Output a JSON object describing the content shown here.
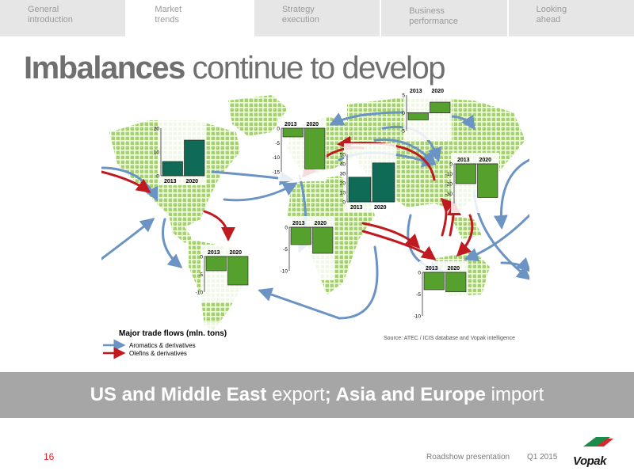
{
  "tabs": [
    {
      "label": "General\nintroduction"
    },
    {
      "label": "Market\ntrends"
    },
    {
      "label": "Strategy\nexecution"
    },
    {
      "label": "Business\nperformance"
    },
    {
      "label": "Looking\nahead"
    }
  ],
  "title": {
    "bold": "Imbalances",
    "rest": " continue to develop"
  },
  "map": {
    "legend_title": "Major trade flows (mln. tons)",
    "legend_items": [
      {
        "label": "Aromatics & derivatives",
        "color": "#6b93c4"
      },
      {
        "label": "Olefins & derivatives",
        "color": "#c0191f"
      }
    ],
    "source": "Source: ATEC / ICIS database and Vopak intelligence"
  },
  "colors": {
    "dark_green": "#0f6b55",
    "light_green": "#56a02d",
    "land": "#9fcf6c",
    "flow_blue": "#6b93c4",
    "flow_red": "#c0191f"
  },
  "chart_data": [
    {
      "type": "bar",
      "region": "North America",
      "categories": [
        "2013",
        "2020"
      ],
      "values": [
        6,
        15
      ],
      "ylim": [
        0,
        20
      ],
      "yticks": [
        "20",
        "10",
        "0"
      ]
    },
    {
      "type": "bar",
      "region": "South America",
      "categories": [
        "2013",
        "2020"
      ],
      "values": [
        -4,
        -8
      ],
      "ylim": [
        -10,
        0
      ],
      "yticks": [
        "0",
        "-5",
        "-10"
      ]
    },
    {
      "type": "bar",
      "region": "Europe",
      "categories": [
        "2013",
        "2020"
      ],
      "values": [
        -3,
        -14
      ],
      "ylim": [
        -15,
        0
      ],
      "yticks": [
        "0",
        "-5",
        "-10",
        "-15"
      ]
    },
    {
      "type": "bar",
      "region": "Africa",
      "categories": [
        "2013",
        "2020"
      ],
      "values": [
        -4,
        -6
      ],
      "ylim": [
        -10,
        0
      ],
      "yticks": [
        "0",
        "-5",
        "-10"
      ]
    },
    {
      "type": "bar",
      "region": "Middle East",
      "categories": [
        "2013",
        "2020"
      ],
      "values": [
        26,
        41
      ],
      "ylim": [
        0,
        50
      ],
      "yticks": [
        "50",
        "40",
        "30",
        "20",
        "10",
        "0"
      ]
    },
    {
      "type": "bar",
      "region": "Russia",
      "categories": [
        "2013",
        "2020"
      ],
      "values": [
        -2,
        3
      ],
      "ylim": [
        -5,
        5
      ],
      "yticks": [
        "5",
        "0",
        "-5"
      ]
    },
    {
      "type": "bar",
      "region": "Asia",
      "categories": [
        "2013",
        "2020"
      ],
      "values": [
        -20,
        -34
      ],
      "ylim": [
        -40,
        0
      ],
      "yticks": [
        "0",
        "-10",
        "-20",
        "-30"
      ]
    },
    {
      "type": "bar",
      "region": "Oceania / SE Asia",
      "categories": [
        "2013",
        "2020"
      ],
      "values": [
        -4,
        -4.5
      ],
      "ylim": [
        -10,
        0
      ],
      "yticks": [
        "0",
        "-5",
        "-10"
      ]
    }
  ],
  "banner": {
    "bold1": "US and Middle East",
    "text1": " export",
    "bold2": "; Asia and Europe",
    "text2": " import"
  },
  "footer": {
    "page": "16",
    "presentation": "Roadshow presentation",
    "quarter": "Q1 2015",
    "logo": "Vopak"
  }
}
